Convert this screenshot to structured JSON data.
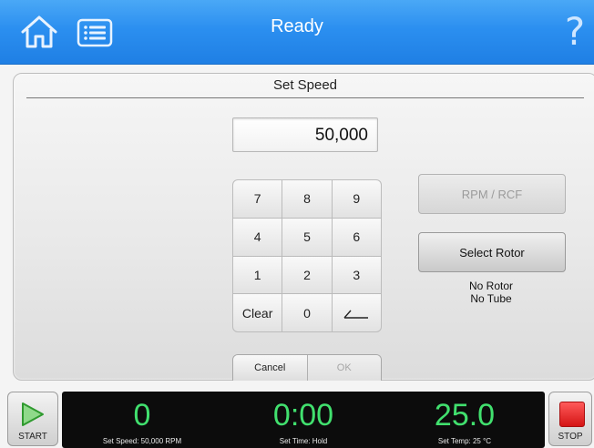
{
  "header": {
    "title": "Ready",
    "help_label": "?",
    "icons": [
      "home-icon",
      "list-icon",
      "help-icon"
    ]
  },
  "panel": {
    "title": "Set Speed",
    "display_value": "50,000",
    "keypad": [
      "7",
      "8",
      "9",
      "4",
      "5",
      "6",
      "1",
      "2",
      "3",
      "Clear",
      "0",
      "←"
    ],
    "rpm_rcf_label": "RPM / RCF",
    "select_rotor_label": "Select Rotor",
    "rotor_status_line1": "No Rotor",
    "rotor_status_line2": "No Tube",
    "cancel_label": "Cancel",
    "ok_label": "OK"
  },
  "footer": {
    "start_label": "START",
    "stop_label": "STOP",
    "speed_value": "0",
    "speed_set_label": "Set Speed: 50,000 RPM",
    "time_value": "0:00",
    "time_set_label": "Set Time: Hold",
    "temp_value": "25.0",
    "temp_set_label": "Set Temp: 25 °C"
  },
  "colors": {
    "header_blue": "#2b8ff0",
    "status_green": "#41e06e",
    "stop_red": "#e02020"
  }
}
